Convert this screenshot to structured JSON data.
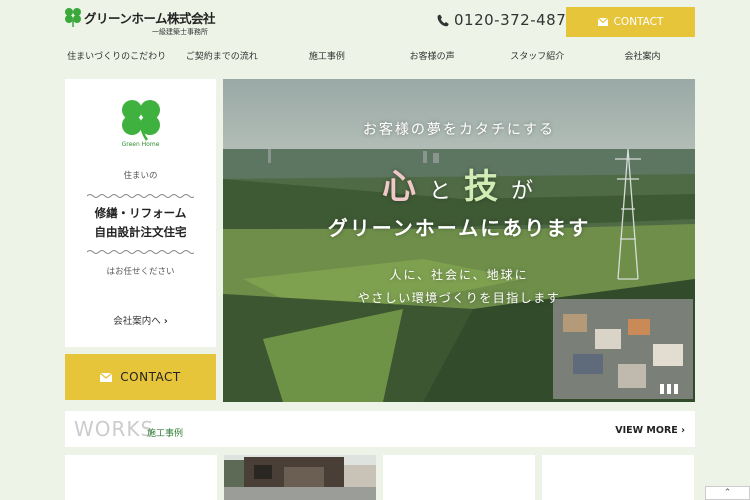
{
  "header": {
    "logo_name": "グリーンホーム株式会社",
    "logo_sub": "一級建築士事務所",
    "phone": "0120-372-487",
    "contact_label": "CONTACT"
  },
  "nav": {
    "items": [
      "住まいづくりのこだわり",
      "ご契約までの流れ",
      "施工事例",
      "お客様の声",
      "スタッフ紹介",
      "会社案内"
    ]
  },
  "side": {
    "brand": "Green Home",
    "tag1": "住まいの",
    "line1": "修繕・リフォーム",
    "line2": "自由設計注文住宅",
    "tag2": "はお任せください",
    "link": "会社案内へ",
    "contact_label": "CONTACT"
  },
  "hero": {
    "line1": "お客様の夢をカタチにする",
    "big1": "心",
    "mid1": "と",
    "big2": "技",
    "mid2": "が",
    "line3": "グリーンホームにあります",
    "line4": "人に、社会に、地球に",
    "line5": "やさしい環境づくりを目指します"
  },
  "works": {
    "title": "WORKS",
    "sub": "施工事例",
    "view_more": "VIEW MORE"
  },
  "colors": {
    "background": "#edf3e6",
    "accent_yellow": "#e6c53a",
    "brand_green": "#2e8b2e"
  }
}
